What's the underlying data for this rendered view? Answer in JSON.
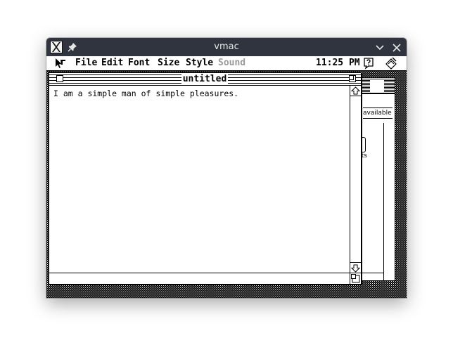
{
  "window": {
    "title": "vmac"
  },
  "menubar": {
    "items": [
      {
        "label": "File",
        "enabled": true
      },
      {
        "label": "Edit",
        "enabled": true
      },
      {
        "label": "Font",
        "enabled": true
      },
      {
        "label": "Size",
        "enabled": true
      },
      {
        "label": "Style",
        "enabled": true
      },
      {
        "label": "Sound",
        "enabled": false
      }
    ],
    "clock": "11:25 PM",
    "help_icon": "question-balloon-icon",
    "app_icon": "application-icon"
  },
  "document": {
    "title": "untitled",
    "text": "I am a simple man of simple pleasures."
  },
  "background_window": {
    "availability_text": "available",
    "fragment_text": "nts"
  },
  "colors": {
    "titlebar_bg": "#2f343f",
    "titlebar_text": "#e6e6e6",
    "mac_black": "#000000",
    "mac_white": "#ffffff",
    "disabled_text": "#9a9a9a"
  }
}
